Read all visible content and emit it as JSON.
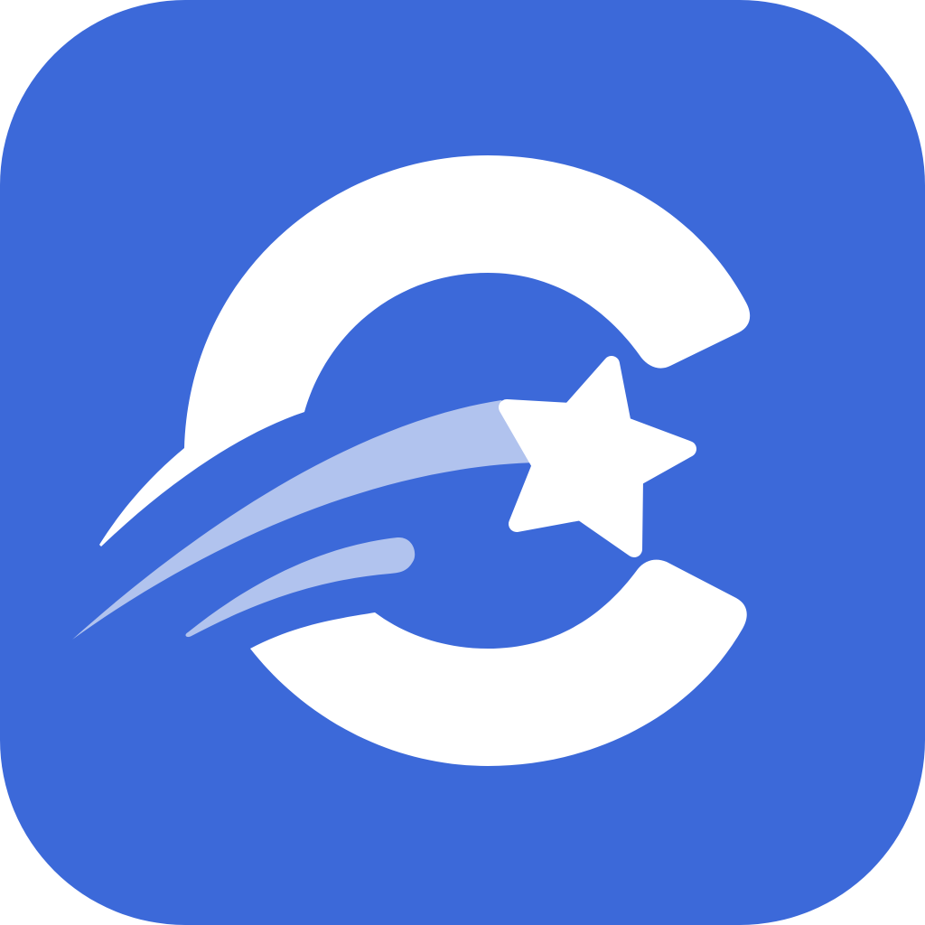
{
  "icon": {
    "name": "app-icon",
    "depicts": [
      "letter-c-logo",
      "shooting-star",
      "star-trail"
    ],
    "colors": {
      "background": "#3C69D9",
      "glyph": "#FFFFFF",
      "trail": "#B1C3EE"
    }
  }
}
